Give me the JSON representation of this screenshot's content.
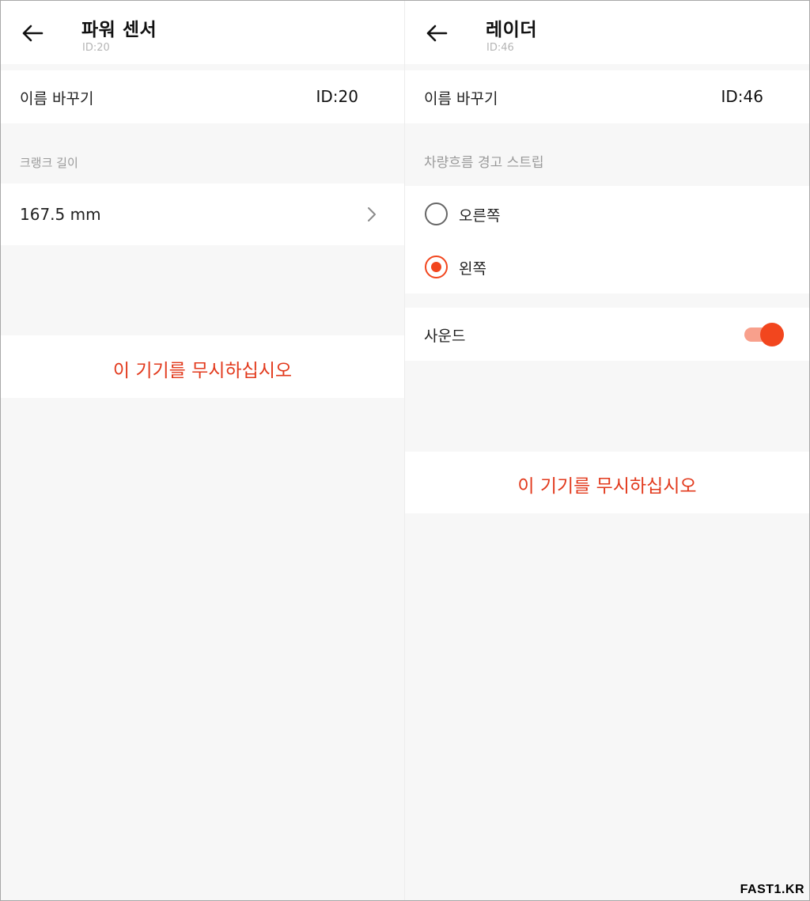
{
  "left": {
    "header": {
      "title": "파워 센서",
      "subtitle": "ID:20"
    },
    "rename": {
      "label": "이름 바꾸기",
      "value": "ID:20"
    },
    "crank": {
      "caption": "크랭크 길이",
      "value": "167.5 mm"
    },
    "ignore_label": "이 기기를 무시하십시오"
  },
  "right": {
    "header": {
      "title": "레이더",
      "subtitle": "ID:46"
    },
    "rename": {
      "label": "이름 바꾸기",
      "value": "ID:46"
    },
    "strip": {
      "caption": "차량흐름 경고 스트립",
      "options": [
        {
          "label": "오른쪽",
          "selected": false
        },
        {
          "label": "왼쪽",
          "selected": true
        }
      ]
    },
    "sound": {
      "label": "사운드",
      "enabled": true
    },
    "ignore_label": "이 기기를 무시하십시오"
  },
  "watermark": "FAST1.KR",
  "colors": {
    "accent": "#f2461e",
    "danger_text": "#e2391c",
    "background": "#f7f7f7"
  }
}
